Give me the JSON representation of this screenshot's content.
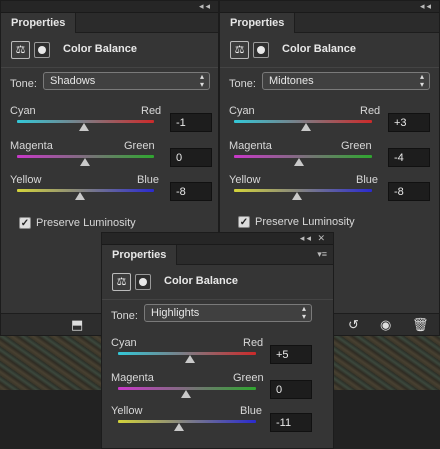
{
  "panels": {
    "left": {
      "tab": "Properties",
      "title": "Color Balance",
      "tone_label": "Tone:",
      "tone_value": "Shadows",
      "sliders": [
        {
          "left": "Cyan",
          "right": "Red",
          "value": "-1"
        },
        {
          "left": "Magenta",
          "right": "Green",
          "value": "0"
        },
        {
          "left": "Yellow",
          "right": "Blue",
          "value": "-8"
        }
      ],
      "preserve_label": "Preserve Luminosity"
    },
    "middle": {
      "tab": "Properties",
      "title": "Color Balance",
      "tone_label": "Tone:",
      "tone_value": "Midtones",
      "sliders": [
        {
          "left": "Cyan",
          "right": "Red",
          "value": "+3"
        },
        {
          "left": "Magenta",
          "right": "Green",
          "value": "-4"
        },
        {
          "left": "Yellow",
          "right": "Blue",
          "value": "-8"
        }
      ],
      "preserve_label": "Preserve Luminosity"
    },
    "front": {
      "tab": "Properties",
      "title": "Color Balance",
      "tone_label": "Tone:",
      "tone_value": "Highlights",
      "sliders": [
        {
          "left": "Cyan",
          "right": "Red",
          "value": "+5"
        },
        {
          "left": "Magenta",
          "right": "Green",
          "value": "0"
        },
        {
          "left": "Yellow",
          "right": "Blue",
          "value": "-11"
        }
      ]
    }
  },
  "icons": {
    "collapse": "double-chevron",
    "close": "x",
    "menu": "hamburger",
    "clip": "clip-to-layer",
    "reset": "reset-arrow",
    "visibility": "eye",
    "delete": "trash"
  }
}
